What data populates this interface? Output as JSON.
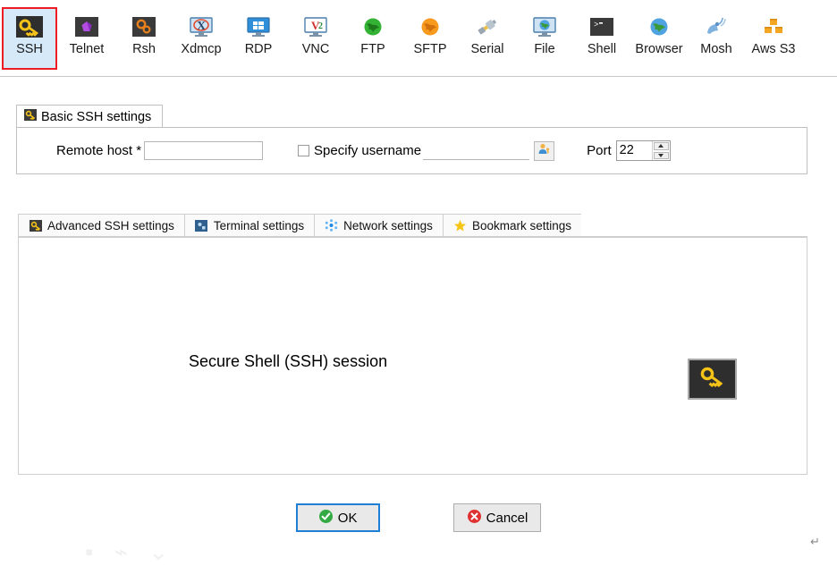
{
  "window": {
    "dialog_kind": "session-settings"
  },
  "session_toolbar": {
    "items": [
      {
        "label": "SSH",
        "icon": "ssh-key-icon",
        "selected": true
      },
      {
        "label": "Telnet",
        "icon": "telnet-gem-icon",
        "selected": false
      },
      {
        "label": "Rsh",
        "icon": "rsh-gears-icon",
        "selected": false
      },
      {
        "label": "Xdmcp",
        "icon": "xdmcp-monitor-icon",
        "selected": false
      },
      {
        "label": "RDP",
        "icon": "rdp-windows-icon",
        "selected": false
      },
      {
        "label": "VNC",
        "icon": "vnc-monitor-icon",
        "selected": false
      },
      {
        "label": "FTP",
        "icon": "ftp-green-globe-icon",
        "selected": false
      },
      {
        "label": "SFTP",
        "icon": "sftp-orange-globe-icon",
        "selected": false
      },
      {
        "label": "Serial",
        "icon": "serial-plug-icon",
        "selected": false
      },
      {
        "label": "File",
        "icon": "file-monitor-globe-icon",
        "selected": false
      },
      {
        "label": "Shell",
        "icon": "shell-console-icon",
        "selected": false
      },
      {
        "label": "Browser",
        "icon": "browser-globe-icon",
        "selected": false
      },
      {
        "label": "Mosh",
        "icon": "mosh-satellite-icon",
        "selected": false
      },
      {
        "label": "Aws S3",
        "icon": "aws-s3-boxes-icon",
        "selected": false
      }
    ]
  },
  "basic_settings": {
    "group_title": "Basic SSH settings",
    "group_icon": "key-icon",
    "remote_host": {
      "label": "Remote host *",
      "value": "",
      "placeholder": ""
    },
    "specify_username": {
      "label": "Specify username",
      "checked": false,
      "value": "",
      "placeholder": ""
    },
    "user_picker_button": {
      "icon": "user-key-icon",
      "label": ""
    },
    "port": {
      "label": "Port",
      "value": "22"
    }
  },
  "settings_tabs": {
    "items": [
      {
        "label": "Advanced SSH settings",
        "icon": "key-icon"
      },
      {
        "label": "Terminal settings",
        "icon": "terminal-icon"
      },
      {
        "label": "Network settings",
        "icon": "network-dots-icon"
      },
      {
        "label": "Bookmark settings",
        "icon": "star-icon"
      }
    ],
    "active_index": 0,
    "panel": {
      "description": "Secure Shell (SSH) session",
      "badge_icon": "ssh-key-icon"
    }
  },
  "footer": {
    "ok": {
      "label": "OK",
      "icon": "green-check-icon",
      "focused": true
    },
    "cancel": {
      "label": "Cancel",
      "icon": "red-x-icon",
      "focused": false
    }
  },
  "decorations": {
    "watermark_text": "▪ ⌁ ⌄",
    "return_mark": "↵"
  },
  "colors": {
    "selection_fill": "#d6e9f8",
    "selection_border": "#ee1c25",
    "focus_border": "#1f7fd4",
    "ok_green": "#33aa44",
    "cancel_red": "#e03131",
    "key_yellow": "#f5c318",
    "panel_border": "#cfcfcf"
  }
}
